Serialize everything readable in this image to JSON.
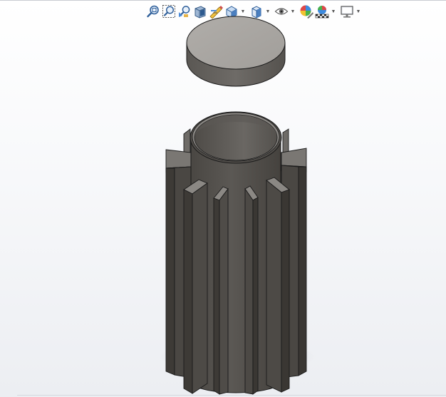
{
  "viewport": {
    "background_top": "#ffffff",
    "background_bottom": "#eceef2"
  },
  "toolbar": {
    "buttons": [
      {
        "name": "zoom-to-fit-icon",
        "has_dropdown": false
      },
      {
        "name": "zoom-to-area-icon",
        "has_dropdown": false
      },
      {
        "name": "previous-view-icon",
        "has_dropdown": false
      },
      {
        "name": "section-view-icon",
        "has_dropdown": false
      },
      {
        "name": "dynamic-annotation-views-icon",
        "has_dropdown": false
      },
      {
        "name": "view-orientation-icon",
        "has_dropdown": true
      },
      {
        "name": "display-style-icon",
        "has_dropdown": true
      },
      {
        "name": "hide-show-items-icon",
        "has_dropdown": true
      },
      {
        "name": "edit-appearance-icon",
        "has_dropdown": false
      },
      {
        "name": "apply-scene-icon",
        "has_dropdown": true
      },
      {
        "name": "view-settings-icon",
        "has_dropdown": true
      }
    ]
  },
  "model": {
    "parts": [
      "lid",
      "finned-cylinder"
    ],
    "face_color_light": "#a9a6a2",
    "face_color_dark": "#4f4c48",
    "edge_color": "#1a1a1a"
  }
}
